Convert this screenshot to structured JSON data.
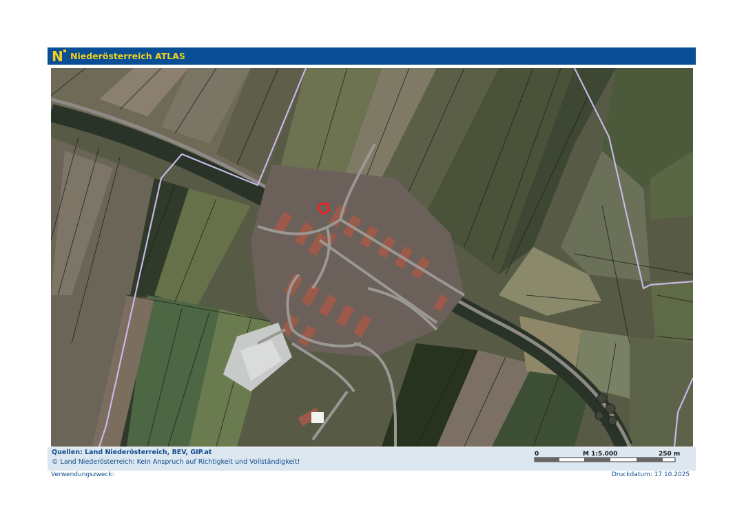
{
  "header": {
    "title": "Niederösterreich ATLAS",
    "logo_letter": "N"
  },
  "map": {
    "type": "aerial-orthophoto",
    "marker": {
      "shape": "parcel-outline",
      "color": "#ff1a1a"
    },
    "boundary_color": "#c9b7e6"
  },
  "footer": {
    "sources": "Quellen: Land Niederösterreich, BEV, GIP.at",
    "copyright": "© Land Niederösterreich: Kein Anspruch auf Richtigkeit und Vollständigkeit!"
  },
  "scale": {
    "start": "0",
    "label": "M 1:5.000",
    "end": "250 m"
  },
  "usage_label": "Verwendungszweck:",
  "print_date": "Druckdatum: 17.10.2025",
  "colors": {
    "header_bg": "#0a4f95",
    "header_text": "#f2cf1e",
    "footer_bg": "#dde7f0",
    "footer_text": "#0f4a8c"
  }
}
